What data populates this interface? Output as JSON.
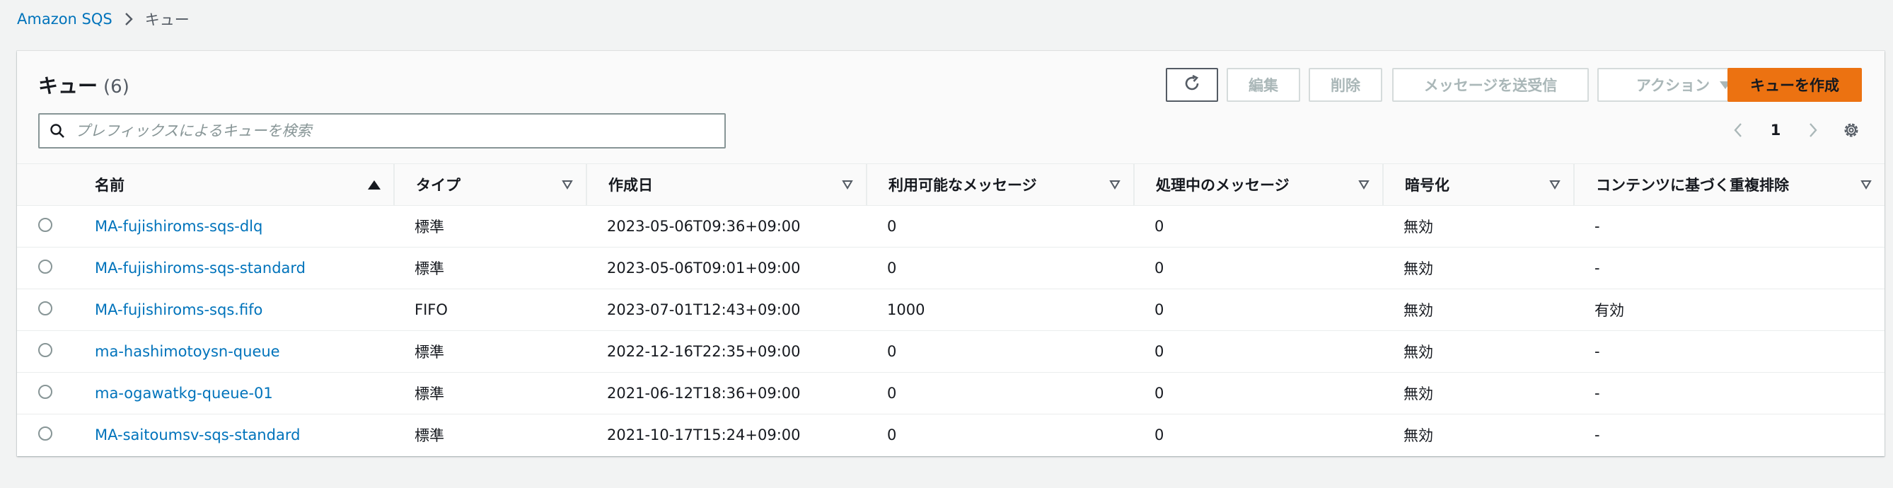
{
  "breadcrumb": {
    "root": "Amazon SQS",
    "current": "キュー"
  },
  "header": {
    "title": "キュー",
    "count": "(6)"
  },
  "toolbar": {
    "edit": "編集",
    "delete": "削除",
    "send_receive": "メッセージを送受信",
    "actions": "アクション",
    "create": "キューを作成"
  },
  "search": {
    "placeholder": "プレフィックスによるキューを検索",
    "value": ""
  },
  "pagination": {
    "page": "1"
  },
  "table": {
    "columns": {
      "name": "名前",
      "type": "タイプ",
      "created": "作成日",
      "available": "利用可能なメッセージ",
      "in_flight": "処理中のメッセージ",
      "encryption": "暗号化",
      "dedup": "コンテンツに基づく重複排除"
    },
    "rows": [
      {
        "name": "MA-fujishiroms-sqs-dlq",
        "type": "標準",
        "created": "2023-05-06T09:36+09:00",
        "available": "0",
        "in_flight": "0",
        "encryption": "無効",
        "dedup": "-"
      },
      {
        "name": "MA-fujishiroms-sqs-standard",
        "type": "標準",
        "created": "2023-05-06T09:01+09:00",
        "available": "0",
        "in_flight": "0",
        "encryption": "無効",
        "dedup": "-"
      },
      {
        "name": "MA-fujishiroms-sqs.fifo",
        "type": "FIFO",
        "created": "2023-07-01T12:43+09:00",
        "available": "1000",
        "in_flight": "0",
        "encryption": "無効",
        "dedup": "有効"
      },
      {
        "name": "ma-hashimotoysn-queue",
        "type": "標準",
        "created": "2022-12-16T22:35+09:00",
        "available": "0",
        "in_flight": "0",
        "encryption": "無効",
        "dedup": "-"
      },
      {
        "name": "ma-ogawatkg-queue-01",
        "type": "標準",
        "created": "2021-06-12T18:36+09:00",
        "available": "0",
        "in_flight": "0",
        "encryption": "無効",
        "dedup": "-"
      },
      {
        "name": "MA-saitoumsv-sqs-standard",
        "type": "標準",
        "created": "2021-10-17T15:24+09:00",
        "available": "0",
        "in_flight": "0",
        "encryption": "無効",
        "dedup": "-"
      }
    ]
  },
  "icons": {
    "breadcrumb_separator": "chevron-right-icon",
    "refresh": "refresh-icon",
    "search": "search-icon",
    "prev": "chevron-left-icon",
    "next": "chevron-right-icon",
    "settings": "gear-icon",
    "sort_asc": "caret-up-icon",
    "sort_none": "caret-down-outline-icon",
    "actions_dropdown": "caret-down-icon"
  },
  "colors": {
    "link": "#0073bb",
    "primary": "#ec7211",
    "disabled_text": "#aab7b8"
  }
}
